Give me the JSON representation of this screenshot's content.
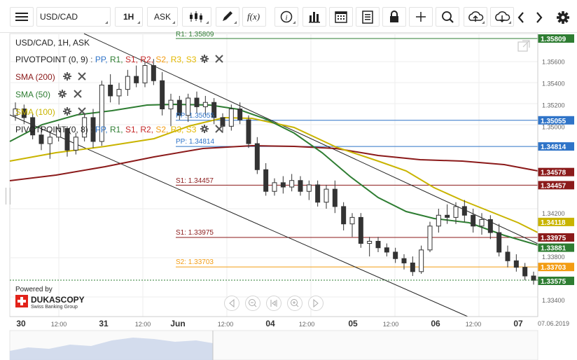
{
  "toolbar": {
    "symbol": "USD/CAD",
    "timeframe": "1H",
    "price_side": "ASK",
    "fx_label": "f(x)",
    "icons": [
      "menu-icon",
      "candlestick-icon",
      "pencil-icon",
      "function-icon",
      "info-icon",
      "bar-chart-icon",
      "calendar-icon",
      "document-icon",
      "lock-icon",
      "crosshair-icon",
      "zoom-icon",
      "upload-icon",
      "download-icon",
      "chevron-left-icon",
      "chevron-right-icon",
      "gear-icon"
    ]
  },
  "legend": {
    "header": "USD/CAD, 1H, ASK",
    "pivot1_name": "PIVOTPOINT (0, 9)",
    "pivot2_name": "PIVOTPOINT (0, 8)",
    "pivot_parts": [
      ":",
      "PP,",
      "R1,",
      "S1,",
      "R2,",
      "S2,",
      "R3,",
      "S3"
    ],
    "pivot_colors": [
      "#555555",
      "#2f74c8",
      "#2e7d32",
      "#c62828",
      "#c62828",
      "#f39c12",
      "#e3b800",
      "#e3b800"
    ],
    "sma200": "SMA (200)",
    "sma50": "SMA (50)",
    "sma100": "SMA (100)",
    "sma200_color": "#8b1a1a",
    "sma50_color": "#2e7d32",
    "sma100_color": "#c9b400"
  },
  "levels": {
    "r1": "R1: 1.35809",
    "pp_a": "PP: 1.35055",
    "pp_b": "PP: 1.34814",
    "s1_a": "S1: 1.34457",
    "s1_b": "S1: 1.33975",
    "s2": "S2: 1.33703"
  },
  "price_tags": [
    {
      "text": "1.35809",
      "color": "#2e7d32"
    },
    {
      "text": "1.35055",
      "color": "#2f74c8"
    },
    {
      "text": "1.34814",
      "color": "#2f74c8"
    },
    {
      "text": "1.34578",
      "color": "#8b1a1a"
    },
    {
      "text": "1.34457",
      "color": "#8b1a1a"
    },
    {
      "text": "1.34118",
      "color": "#c9b400"
    },
    {
      "text": "1.33975",
      "color": "#8b1a1a"
    },
    {
      "text": "1.33881",
      "color": "#2e7d32"
    },
    {
      "text": "1.33703",
      "color": "#f39c12"
    },
    {
      "text": "1.33575",
      "color": "#2e7d32"
    }
  ],
  "y_ticks": [
    "1.35600",
    "1.35400",
    "1.35200",
    "1.35000",
    "1.34200",
    "1.33800",
    "1.33400"
  ],
  "x_ticks": [
    "30",
    "12:00",
    "31",
    "12:00",
    "Jun",
    "12:00",
    "04",
    "12:00",
    "05",
    "12:00",
    "06",
    "12:00",
    "07"
  ],
  "date_label": "07.06.2019",
  "branding": {
    "powered_by": "Powered by",
    "name": "DUKASCOPY",
    "tagline": "Swiss Banking Group"
  },
  "colors": {
    "bull": "#ffffff",
    "bear": "#333333",
    "accent_blue": "#2f74c8",
    "grid": "#eeeeee"
  }
}
